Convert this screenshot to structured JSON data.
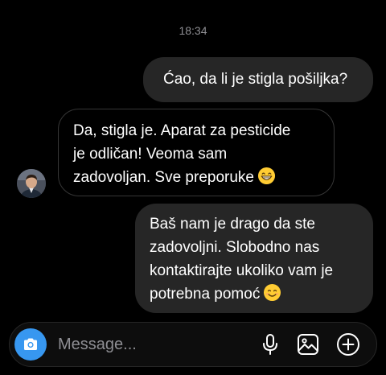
{
  "status": {
    "time": "18:34"
  },
  "messages": [
    {
      "direction": "outgoing",
      "lines": [
        "Ćao, da li je stigla pošiljka?"
      ],
      "emoji": ""
    },
    {
      "direction": "incoming",
      "lines": [
        "Da, stigla je. Aparat za pesticide",
        "je odličan! Veoma sam",
        "zadovoljan. Sve preporuke"
      ],
      "emoji": "grinning-face-emoji"
    },
    {
      "direction": "outgoing",
      "lines": [
        "Baš nam je drago da ste",
        "zadovoljni. Slobodno nas",
        "kontaktirajte ukoliko vam je",
        "potrebna pomoć"
      ],
      "emoji": "smiling-face-emoji"
    }
  ],
  "composer": {
    "placeholder": "Message...",
    "icons": [
      "camera-icon",
      "microphone-icon",
      "gallery-icon",
      "plus-icon"
    ]
  },
  "colors": {
    "background": "#000000",
    "outgoing_bubble": "#262626",
    "incoming_border": "#363636",
    "accent": "#3797f0",
    "muted_text": "#8e8e93",
    "emoji_yellow": "#ffcc33"
  }
}
